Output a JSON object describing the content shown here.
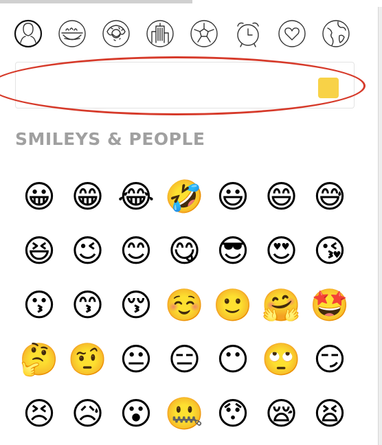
{
  "categories": [
    {
      "id": "smileys-people",
      "icon": "person-icon"
    },
    {
      "id": "animals-nature",
      "icon": "cup-icon"
    },
    {
      "id": "food-drink",
      "icon": "donut-icon"
    },
    {
      "id": "travel-places",
      "icon": "building-icon"
    },
    {
      "id": "activity",
      "icon": "soccer-ball-icon"
    },
    {
      "id": "objects",
      "icon": "alarm-clock-icon"
    },
    {
      "id": "symbols",
      "icon": "heart-icon"
    },
    {
      "id": "flags",
      "icon": "globe-icon"
    }
  ],
  "search": {
    "value": "",
    "placeholder": "",
    "skin_tone_color": "#F8D247"
  },
  "section": {
    "title": "SMILEYS & PEOPLE"
  },
  "emojis": [
    "😀",
    "😁",
    "😂",
    "🤣",
    "😃",
    "😄",
    "😅",
    "😆",
    "😉",
    "😊",
    "😋",
    "😎",
    "😍",
    "😘",
    "😗",
    "😙",
    "😚",
    "☺️",
    "🙂",
    "🤗",
    "🤩",
    "🤔",
    "🤨",
    "😐",
    "😑",
    "😶",
    "🙄",
    "😏",
    "😣",
    "😥",
    "😮",
    "🤐",
    "😯",
    "😪",
    "😫"
  ],
  "colors": {
    "accent": "#D63A2A",
    "section_title": "#A0A0A0"
  }
}
